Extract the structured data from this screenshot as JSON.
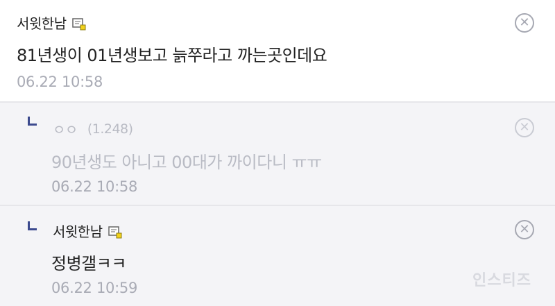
{
  "comments": [
    {
      "author": "서윗한남",
      "text": "81년생이 01년생보고 늙쭈라고 까는곳인데요",
      "date": "06.22 10:58"
    },
    {
      "author": "ㅇㅇ",
      "ip": "(1.248)",
      "text": "90년생도 아니고 00대가 까이다니 ㅠㅠ",
      "date": "06.22 10:58"
    },
    {
      "author": "서윗한남",
      "text": "정병갤ㅋㅋ",
      "date": "06.22 10:59"
    }
  ],
  "icons": {
    "close": "close-icon",
    "reply": "reply-arrow-icon",
    "member_badge": "fixed-nick-badge-icon"
  },
  "watermark": "인스티즈",
  "colors": {
    "reply_arrow": "#3c4a8e",
    "badge_yellow": "#f2d21b",
    "muted_text": "#b9bbc4",
    "reply_background": "#f4f4f7"
  }
}
